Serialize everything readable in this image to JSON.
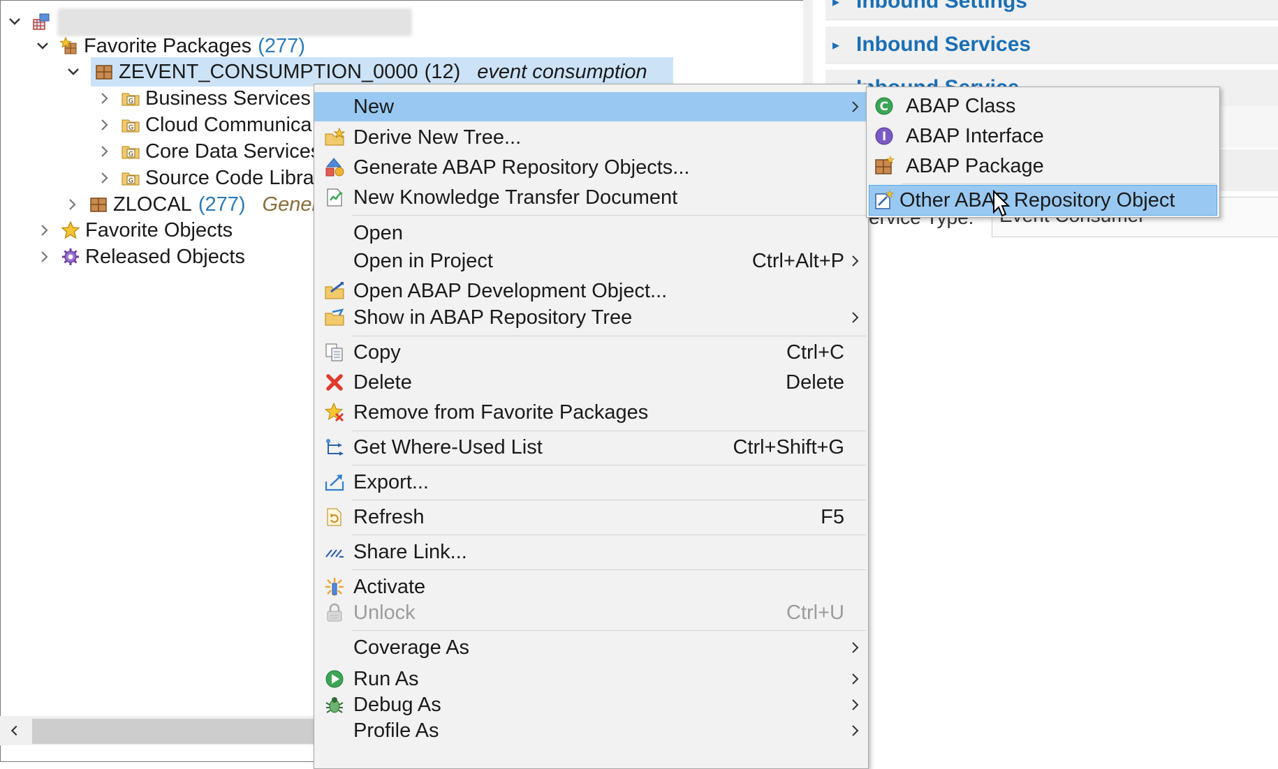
{
  "tree": {
    "root": {
      "label": ""
    },
    "favorite_packages": {
      "label": "Favorite Packages",
      "count": "(277)"
    },
    "zevent": {
      "label": "ZEVENT_CONSUMPTION_0000",
      "count": "(12)",
      "desc": "event consumption"
    },
    "children": [
      {
        "label": "Business Services",
        "count": "("
      },
      {
        "label": "Cloud Communica",
        "count": ""
      },
      {
        "label": "Core Data Services",
        "count": ""
      },
      {
        "label": "Source Code Librar",
        "count": ""
      }
    ],
    "zlocal": {
      "label": "ZLOCAL",
      "count": "(277)",
      "desc": "Genera"
    },
    "favorite_objects": {
      "label": "Favorite Objects"
    },
    "released_objects": {
      "label": "Released Objects"
    }
  },
  "right_pane": {
    "sections": [
      "Inbound Settings",
      "Inbound Services",
      "Inbound Service"
    ],
    "field_label": "ervice Type:",
    "field_value": "Event Consumer"
  },
  "context_menu": {
    "items": [
      {
        "label": "New",
        "shortcut": "",
        "submenu": true,
        "icon": "none",
        "highlighted": true
      },
      {
        "label": "Derive New Tree...",
        "shortcut": "",
        "submenu": false,
        "icon": "derive-tree-icon"
      },
      {
        "label": "Generate ABAP Repository Objects...",
        "shortcut": "",
        "submenu": false,
        "icon": "generate-icon"
      },
      {
        "label": "New Knowledge Transfer Document",
        "shortcut": "",
        "submenu": false,
        "icon": "ktd-icon"
      },
      {
        "label": "Open",
        "shortcut": "",
        "submenu": false,
        "icon": "none"
      },
      {
        "label": "Open in Project",
        "shortcut": "Ctrl+Alt+P",
        "submenu": true,
        "icon": "none"
      },
      {
        "label": "Open ABAP Development Object...",
        "shortcut": "",
        "submenu": false,
        "icon": "open-object-icon"
      },
      {
        "label": "Show in ABAP Repository Tree",
        "shortcut": "",
        "submenu": true,
        "icon": "show-tree-icon"
      },
      {
        "label": "Copy",
        "shortcut": "Ctrl+C",
        "submenu": false,
        "icon": "copy-icon"
      },
      {
        "label": "Delete",
        "shortcut": "Delete",
        "submenu": false,
        "icon": "delete-icon"
      },
      {
        "label": "Remove from Favorite Packages",
        "shortcut": "",
        "submenu": false,
        "icon": "remove-favorite-icon"
      },
      {
        "label": "Get Where-Used List",
        "shortcut": "Ctrl+Shift+G",
        "submenu": false,
        "icon": "where-used-icon"
      },
      {
        "label": "Export...",
        "shortcut": "",
        "submenu": false,
        "icon": "export-icon"
      },
      {
        "label": "Refresh",
        "shortcut": "F5",
        "submenu": false,
        "icon": "refresh-icon"
      },
      {
        "label": "Share Link...",
        "shortcut": "",
        "submenu": false,
        "icon": "share-link-icon"
      },
      {
        "label": "Activate",
        "shortcut": "",
        "submenu": false,
        "icon": "activate-icon"
      },
      {
        "label": "Unlock",
        "shortcut": "Ctrl+U",
        "submenu": false,
        "icon": "unlock-icon",
        "disabled": true
      },
      {
        "label": "Coverage As",
        "shortcut": "",
        "submenu": true,
        "icon": "none"
      },
      {
        "label": "Run As",
        "shortcut": "",
        "submenu": true,
        "icon": "run-icon"
      },
      {
        "label": "Debug As",
        "shortcut": "",
        "submenu": true,
        "icon": "debug-icon"
      },
      {
        "label": "Profile As",
        "shortcut": "",
        "submenu": true,
        "icon": "none"
      }
    ]
  },
  "submenu": {
    "items": [
      {
        "label": "ABAP Class",
        "icon": "abap-class-icon"
      },
      {
        "label": "ABAP Interface",
        "icon": "abap-interface-icon"
      },
      {
        "label": "ABAP Package",
        "icon": "abap-package-icon"
      },
      {
        "label": "Other ABAP Repository Object",
        "icon": "other-object-icon",
        "highlighted": true
      }
    ]
  },
  "colors": {
    "menu_highlight": "#99c9f2",
    "tree_selection": "#cce3f7",
    "count_blue": "#2a7ab8",
    "section_title_blue": "#1a6fb4"
  }
}
